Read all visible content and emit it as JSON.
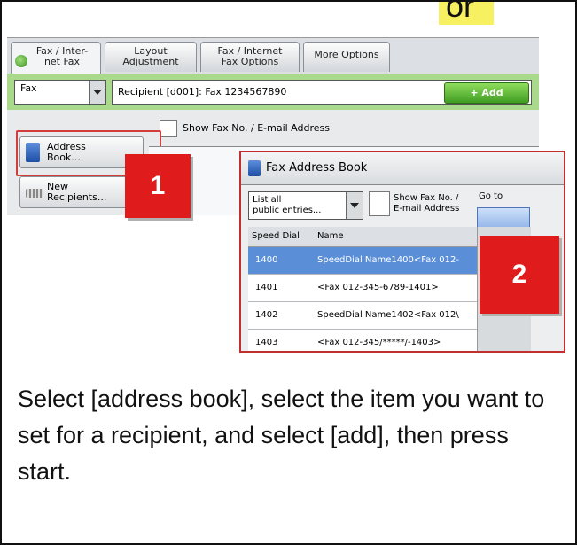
{
  "or_badge": "or",
  "tabs": [
    {
      "label": "Fax / Inter-\nnet Fax"
    },
    {
      "label": "Layout\nAdjustment"
    },
    {
      "label": "Fax / Internet\nFax Options"
    },
    {
      "label": "More Options"
    }
  ],
  "fax_select": {
    "value": "Fax"
  },
  "recipient": {
    "value": "Recipient [d001]: Fax 1234567890"
  },
  "add_button": "+ Add",
  "show_fax_checkbox_label": "Show Fax No. / E-mail Address",
  "side_buttons": {
    "address_book": "Address\nBook...",
    "new_recipients": "New\nRecipients..."
  },
  "callouts": [
    "1",
    "2"
  ],
  "address_book": {
    "title": "Fax Address Book",
    "filter": "List all\npublic entries...",
    "show_fax_label": "Show Fax No. /\nE-mail Address",
    "goto_label": "Go to",
    "columns": [
      "Speed Dial",
      "Name"
    ],
    "rows": [
      {
        "dial": "1400",
        "name": "SpeedDial Name1400<Fax 012-",
        "selected": true
      },
      {
        "dial": "1401",
        "name": "<Fax 012-345-6789-1401>",
        "selected": false
      },
      {
        "dial": "1402",
        "name": "SpeedDial Name1402<Fax 012\\",
        "selected": false
      },
      {
        "dial": "1403",
        "name": "<Fax 012-345/*****/-1403>",
        "selected": false
      }
    ]
  },
  "instructions": "Select [address book], select the item you want to set for a recipient, and select [add], then press start.",
  "colors": {
    "highlight_red": "#e01b1b",
    "green_bar": "#a9d98a",
    "selected_blue": "#5a8fd8",
    "badge_yellow": "#f7f061"
  }
}
